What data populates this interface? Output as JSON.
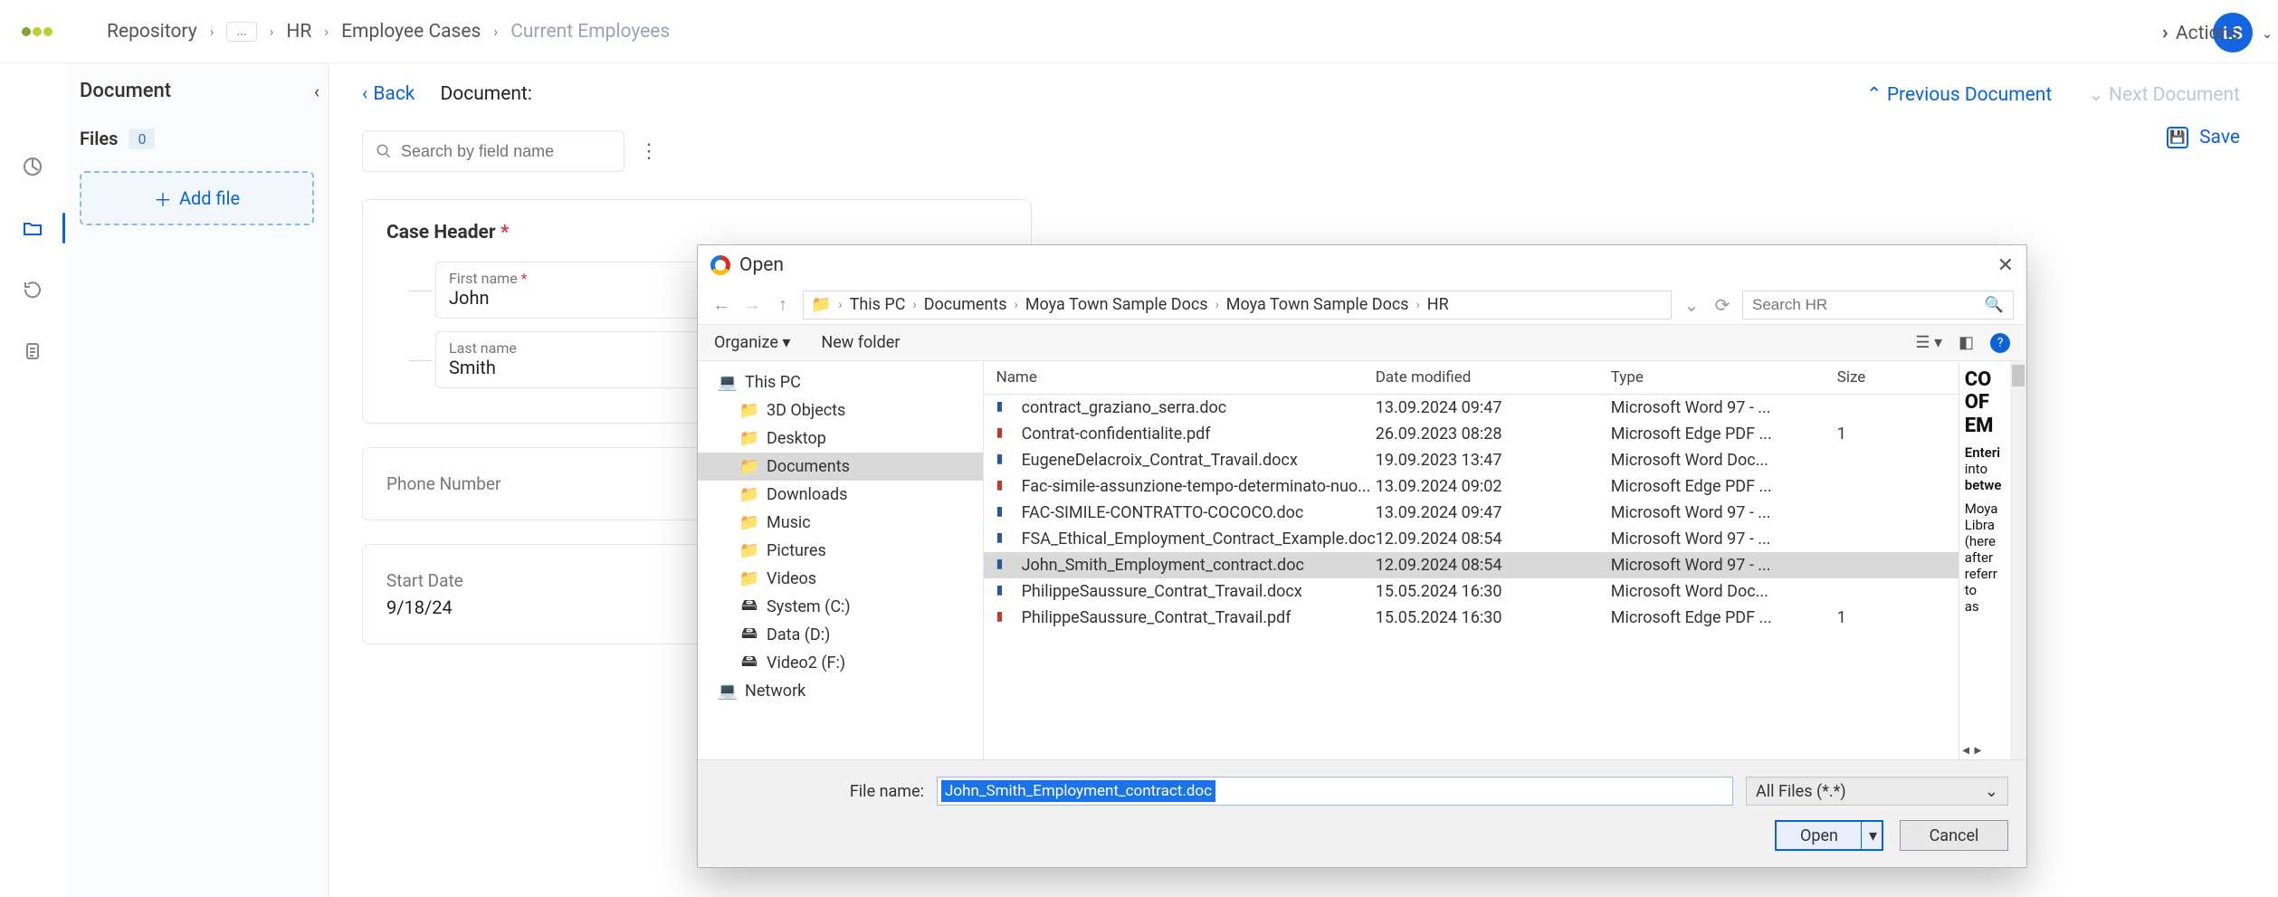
{
  "header": {
    "breadcrumb": [
      "Repository",
      "...",
      "HR",
      "Employee Cases",
      "Current Employees"
    ],
    "avatar_initials": "LS"
  },
  "actionsbar": {
    "actions_label": "Actions"
  },
  "sidebar": {
    "title": "Document",
    "files_label": "Files",
    "files_count": "0",
    "add_file_label": "Add file"
  },
  "mainhead": {
    "back_label": "Back",
    "document_label": "Document:",
    "prev_label": "Previous Document",
    "next_label": "Next Document",
    "save_label": "Save"
  },
  "search": {
    "placeholder": "Search by field name"
  },
  "case_header": {
    "card_title": "Case Header",
    "first_label": "First name",
    "first_value": "John",
    "last_label": "Last name",
    "last_value": "Smith"
  },
  "phone": {
    "label": "Phone Number"
  },
  "start": {
    "label": "Start Date",
    "value": "9/18/24"
  },
  "dialog": {
    "title": "Open",
    "path": [
      "This PC",
      "Documents",
      "Moya Town Sample Docs",
      "Moya Town Sample Docs",
      "HR"
    ],
    "search_placeholder": "Search HR",
    "organize_label": "Organize",
    "newfolder_label": "New folder",
    "tree": [
      {
        "label": "This PC",
        "icon": "pc",
        "indent": false
      },
      {
        "label": "3D Objects",
        "icon": "folder",
        "indent": true
      },
      {
        "label": "Desktop",
        "icon": "folder",
        "indent": true
      },
      {
        "label": "Documents",
        "icon": "folder",
        "indent": true,
        "selected": true
      },
      {
        "label": "Downloads",
        "icon": "folder",
        "indent": true
      },
      {
        "label": "Music",
        "icon": "folder",
        "indent": true
      },
      {
        "label": "Pictures",
        "icon": "folder",
        "indent": true
      },
      {
        "label": "Videos",
        "icon": "folder",
        "indent": true
      },
      {
        "label": "System (C:)",
        "icon": "disk",
        "indent": true
      },
      {
        "label": "Data (D:)",
        "icon": "disk",
        "indent": true
      },
      {
        "label": "Video2 (F:)",
        "icon": "disk",
        "indent": true
      },
      {
        "label": "Network",
        "icon": "pc",
        "indent": false
      }
    ],
    "columns": {
      "name": "Name",
      "modified": "Date modified",
      "type": "Type",
      "size": "Size"
    },
    "rows": [
      {
        "icon": "doc",
        "name": "contract_graziano_serra.doc",
        "modified": "13.09.2024 09:47",
        "type": "Microsoft Word 97 - ...",
        "size": ""
      },
      {
        "icon": "pdf",
        "name": "Contrat-confidentialite.pdf",
        "modified": "26.09.2023 08:28",
        "type": "Microsoft Edge PDF ...",
        "size": "1"
      },
      {
        "icon": "doc",
        "name": "EugeneDelacroix_Contrat_Travail.docx",
        "modified": "19.09.2023 13:47",
        "type": "Microsoft Word Doc...",
        "size": ""
      },
      {
        "icon": "pdf",
        "name": "Fac-simile-assunzione-tempo-determinato-nuo...",
        "modified": "13.09.2024 09:02",
        "type": "Microsoft Edge PDF ...",
        "size": ""
      },
      {
        "icon": "doc",
        "name": "FAC-SIMILE-CONTRATTO-COCOCO.doc",
        "modified": "13.09.2024 09:47",
        "type": "Microsoft Word 97 - ...",
        "size": ""
      },
      {
        "icon": "doc",
        "name": "FSA_Ethical_Employment_Contract_Example.doc",
        "modified": "12.09.2024 08:54",
        "type": "Microsoft Word 97 - ...",
        "size": ""
      },
      {
        "icon": "doc",
        "name": "John_Smith_Employment_contract.doc",
        "modified": "12.09.2024 08:54",
        "type": "Microsoft Word 97 - ...",
        "size": "",
        "selected": true
      },
      {
        "icon": "doc",
        "name": "PhilippeSaussure_Contrat_Travail.docx",
        "modified": "15.05.2024 16:30",
        "type": "Microsoft Word Doc...",
        "size": ""
      },
      {
        "icon": "pdf",
        "name": "PhilippeSaussure_Contrat_Travail.pdf",
        "modified": "15.05.2024 16:30",
        "type": "Microsoft Edge PDF ...",
        "size": "1"
      }
    ],
    "preview": {
      "line1": "CO",
      "line2": "OF",
      "line3": "EM",
      "p1": "Enteri",
      "p2": "into",
      "p3": "betwe",
      "b1": "Moya",
      "b2": "Libra",
      "b3": "(here",
      "b4": "after",
      "b5": "referr",
      "b6": "to",
      "b7": "as"
    },
    "filename_label": "File name:",
    "filename_value": "John_Smith_Employment_contract.doc",
    "filter_label": "All Files (*.*)",
    "open_btn": "Open",
    "cancel_btn": "Cancel"
  }
}
